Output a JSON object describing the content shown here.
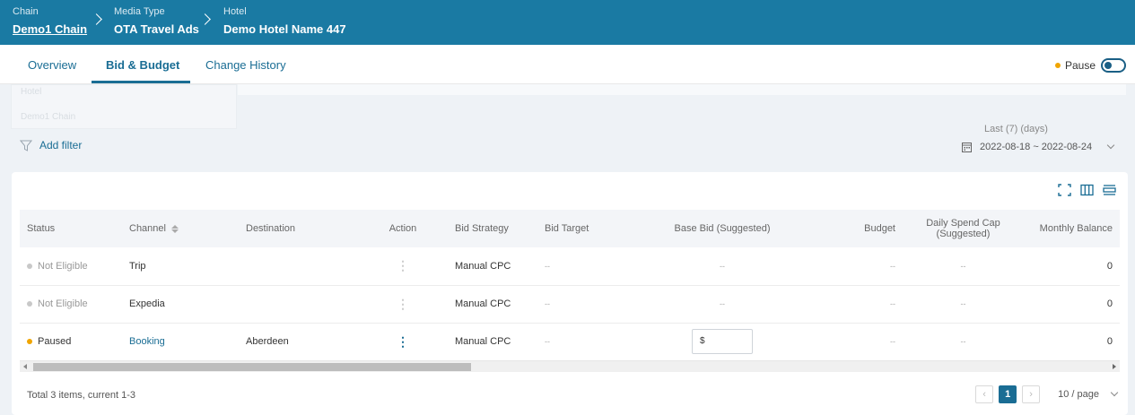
{
  "breadcrumb": [
    {
      "label": "Chain",
      "value": "Demo1 Chain"
    },
    {
      "label": "Media Type",
      "value": "OTA Travel Ads"
    },
    {
      "label": "Hotel",
      "value": "Demo Hotel Name 447"
    }
  ],
  "tabs": [
    {
      "label": "Overview"
    },
    {
      "label": "Bid & Budget"
    },
    {
      "label": "Change History"
    }
  ],
  "pause": {
    "label": "Pause"
  },
  "ghost": {
    "line1": "Hotel",
    "line2": "Demo1 Chain"
  },
  "filter": {
    "add_label": "Add filter"
  },
  "date": {
    "label": "Last (7) (days)",
    "range": "2022-08-18 ~ 2022-08-24"
  },
  "table": {
    "columns": [
      "Status",
      "Channel",
      "Destination",
      "Action",
      "Bid Strategy",
      "Bid Target",
      "Base Bid (Suggested)",
      "Budget",
      "Daily Spend Cap (Suggested)",
      "Monthly Balance"
    ],
    "rows": [
      {
        "status": "Not Eligible",
        "channel": "Trip",
        "destination": "",
        "bid_strategy": "Manual CPC",
        "bid_target": "--",
        "base_bid": "--",
        "budget": "--",
        "daily_cap": "--",
        "monthly_balance": "0"
      },
      {
        "status": "Not Eligible",
        "channel": "Expedia",
        "destination": "",
        "bid_strategy": "Manual CPC",
        "bid_target": "--",
        "base_bid": "--",
        "budget": "--",
        "daily_cap": "--",
        "monthly_balance": "0"
      },
      {
        "status": "Paused",
        "channel": "Booking",
        "destination": "Aberdeen",
        "bid_strategy": "Manual CPC",
        "bid_target": "--",
        "base_bid": "$",
        "budget": "--",
        "daily_cap": "--",
        "monthly_balance": "0"
      }
    ]
  },
  "footer": {
    "total": "Total 3 items, current 1-3",
    "page": "1",
    "page_size": "10 / page"
  },
  "colors": {
    "header": "#1a7aa3",
    "accent": "#1a6d94",
    "paused": "#f0a500",
    "not_eligible": "#c8c8c8"
  }
}
